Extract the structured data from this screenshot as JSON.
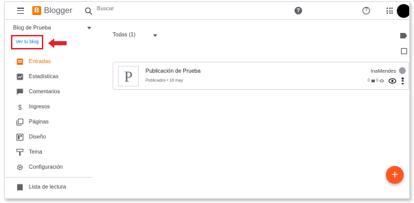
{
  "app": {
    "brand": "Blogger",
    "logo_letter": "B"
  },
  "search": {
    "placeholder": "Buscar"
  },
  "sidebar": {
    "blog_name": "Blog de Prueba",
    "view_blog": "Ver tu blog",
    "items": [
      {
        "label": "Entradas",
        "icon": "posts-icon"
      },
      {
        "label": "Estadísticas",
        "icon": "stats-icon"
      },
      {
        "label": "Comentarios",
        "icon": "comments-icon"
      },
      {
        "label": "Ingresos",
        "icon": "dollar-icon"
      },
      {
        "label": "Páginas",
        "icon": "pages-icon"
      },
      {
        "label": "Diseño",
        "icon": "layout-icon"
      },
      {
        "label": "Tema",
        "icon": "theme-icon"
      },
      {
        "label": "Configuración",
        "icon": "gear-icon"
      }
    ],
    "reading_list": "Lista de lectura"
  },
  "main": {
    "filter": "Todas (1)",
    "posts": [
      {
        "thumb_letter": "P",
        "title": "Publicación de Prueba",
        "meta": "Publicados • 16 may",
        "author": "InaMendes",
        "comments": "0",
        "views": "0"
      }
    ]
  },
  "fab_label": "+",
  "colors": {
    "accent": "#e8710a",
    "fab": "#ff5722",
    "highlight": "#e8202a",
    "logo": "#f57c00"
  }
}
